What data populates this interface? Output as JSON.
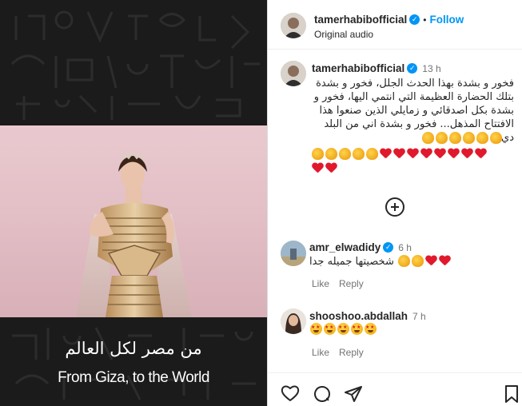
{
  "media": {
    "caption_ar": "من مصر لكل العالم",
    "caption_en": "From Giza, to the World"
  },
  "header": {
    "username": "tamerhabibofficial",
    "follow_label": "Follow",
    "subtitle": "Original audio"
  },
  "post": {
    "username": "tamerhabibofficial",
    "time": "13 h",
    "caption": "فخور و بشدة بهذا الحدث الجلل، فخور و بشدة بتلك الحضارة العظيمة التي انتمي اليها، فخور و بشدة بكل اصدقائي و زمايلي الذين صنعوا هذا الافتتاح المذهل... فخور و بشدة اني من البلد دي",
    "emoji_row1": [
      "clapping-hands",
      "clapping-hands",
      "clapping-hands",
      "clapping-hands",
      "clapping-hands",
      "clapping-hands"
    ],
    "emoji_row2": [
      "clapping-hands",
      "clapping-hands",
      "clapping-hands",
      "clapping-hands",
      "clapping-hands",
      "red-heart",
      "red-heart",
      "red-heart",
      "red-heart",
      "red-heart",
      "red-heart",
      "red-heart",
      "red-heart"
    ],
    "emoji_row3": [
      "red-heart",
      "red-heart"
    ]
  },
  "comments": [
    {
      "username": "amr_elwadidy",
      "time": "6 h",
      "text": "شخصيتها جميله جدا",
      "emojis": [
        "clapping-hands",
        "clapping-hands",
        "red-heart",
        "red-heart"
      ],
      "like_label": "Like",
      "reply_label": "Reply"
    },
    {
      "username": "shooshoo.abdallah",
      "time": "7 h",
      "text": "",
      "emojis": [
        "star-struck",
        "star-struck",
        "star-struck",
        "star-struck",
        "star-struck"
      ],
      "like_label": "Like",
      "reply_label": "Reply"
    }
  ],
  "colors": {
    "accent": "#0095f6",
    "heart": "#e0192d",
    "media_bg": "#1b1b1b"
  },
  "icons": {
    "actions": [
      "heart-icon",
      "comment-icon",
      "share-icon",
      "bookmark-icon"
    ],
    "load_more": "plus-circle-icon"
  }
}
